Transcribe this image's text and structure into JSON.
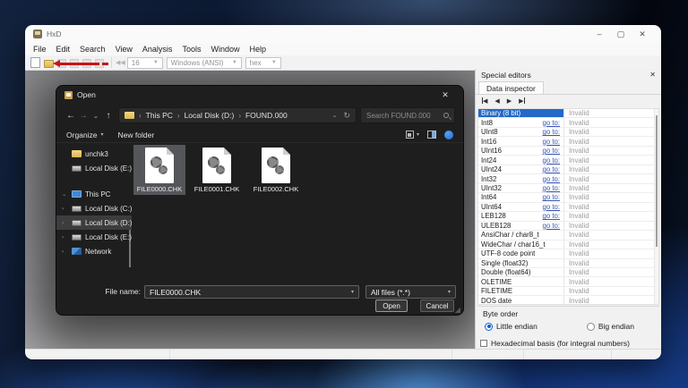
{
  "colors": {
    "selection_blue": "#2468c8",
    "arrow_red": "#c41616",
    "accent": "#0a61c9",
    "dialog_bg": "#1e1e1e"
  },
  "icons": {
    "minimize": "–",
    "maximize": "▢",
    "close": "✕",
    "back": "←",
    "forward": "→",
    "up": "↑",
    "chevron_down": "⌄",
    "chevron_right": "›",
    "refresh": "↻",
    "dropdown": "▾",
    "prev": "◀",
    "next": "▶",
    "expanded": "⌄",
    "collapsed": "›"
  },
  "hxd": {
    "title": "HxD",
    "menu": [
      "File",
      "Edit",
      "Search",
      "View",
      "Analysis",
      "Tools",
      "Window",
      "Help"
    ],
    "toolbar": {
      "bytes_per_row": "16",
      "encoding": "Windows (ANSI)",
      "offset_base": "hex"
    }
  },
  "inspector": {
    "header": "Special editors",
    "tab": "Data inspector",
    "goto_label": "go to:",
    "rows": [
      {
        "name": "Binary (8 bit)",
        "goto": false,
        "value": "Invalid",
        "selected": true
      },
      {
        "name": "Int8",
        "goto": true,
        "value": "Invalid"
      },
      {
        "name": "UInt8",
        "goto": true,
        "value": "Invalid"
      },
      {
        "name": "Int16",
        "goto": true,
        "value": "Invalid"
      },
      {
        "name": "UInt16",
        "goto": true,
        "value": "Invalid"
      },
      {
        "name": "Int24",
        "goto": true,
        "value": "Invalid"
      },
      {
        "name": "UInt24",
        "goto": true,
        "value": "Invalid"
      },
      {
        "name": "Int32",
        "goto": true,
        "value": "Invalid"
      },
      {
        "name": "UInt32",
        "goto": true,
        "value": "Invalid"
      },
      {
        "name": "Int64",
        "goto": true,
        "value": "Invalid"
      },
      {
        "name": "UInt64",
        "goto": true,
        "value": "Invalid"
      },
      {
        "name": "LEB128",
        "goto": true,
        "value": "Invalid"
      },
      {
        "name": "ULEB128",
        "goto": true,
        "value": "Invalid"
      },
      {
        "name": "AnsiChar / char8_t",
        "goto": false,
        "value": "Invalid"
      },
      {
        "name": "WideChar / char16_t",
        "goto": false,
        "value": "Invalid"
      },
      {
        "name": "UTF-8 code point",
        "goto": false,
        "value": "Invalid"
      },
      {
        "name": "Single (float32)",
        "goto": false,
        "value": "Invalid"
      },
      {
        "name": "Double (float64)",
        "goto": false,
        "value": "Invalid"
      },
      {
        "name": "OLETIME",
        "goto": false,
        "value": "Invalid"
      },
      {
        "name": "FILETIME",
        "goto": false,
        "value": "Invalid"
      },
      {
        "name": "DOS date",
        "goto": false,
        "value": "Invalid"
      }
    ],
    "byte_order": {
      "label": "Byte order",
      "little": "Little endian",
      "big": "Big endian",
      "selected": "little"
    },
    "hex_basis_label": "Hexadecimal basis (for integral numbers)",
    "hex_basis_checked": false
  },
  "dialog": {
    "title": "Open",
    "breadcrumb": [
      "This PC",
      "Local Disk (D:)",
      "FOUND.000"
    ],
    "search_placeholder": "Search FOUND.000",
    "organize_label": "Organize",
    "new_folder_label": "New folder",
    "sidebar": [
      {
        "type": "item",
        "icon": "folder",
        "label": "unchk3",
        "chevron": "",
        "selected": false
      },
      {
        "type": "item",
        "icon": "drive",
        "label": "Local Disk (E:)",
        "chevron": "",
        "selected": false
      },
      {
        "type": "gap"
      },
      {
        "type": "item",
        "icon": "pc",
        "label": "This PC",
        "chevron": "expanded",
        "selected": false
      },
      {
        "type": "item",
        "icon": "drive",
        "label": "Local Disk (C:)",
        "chevron": "collapsed",
        "selected": false
      },
      {
        "type": "item",
        "icon": "drive",
        "label": "Local Disk (D:)",
        "chevron": "collapsed",
        "selected": true
      },
      {
        "type": "item",
        "icon": "drive",
        "label": "Local Disk (E:)",
        "chevron": "collapsed",
        "selected": false
      },
      {
        "type": "item",
        "icon": "network",
        "label": "Network",
        "chevron": "collapsed",
        "selected": false
      }
    ],
    "files": [
      {
        "name": "FILE0000.CHK",
        "selected": true
      },
      {
        "name": "FILE0001.CHK",
        "selected": false
      },
      {
        "name": "FILE0002.CHK",
        "selected": false
      }
    ],
    "file_name_label": "File name:",
    "file_name_value": "FILE0000.CHK",
    "file_filter_value": "All files (*.*)",
    "open_label": "Open",
    "cancel_label": "Cancel"
  }
}
